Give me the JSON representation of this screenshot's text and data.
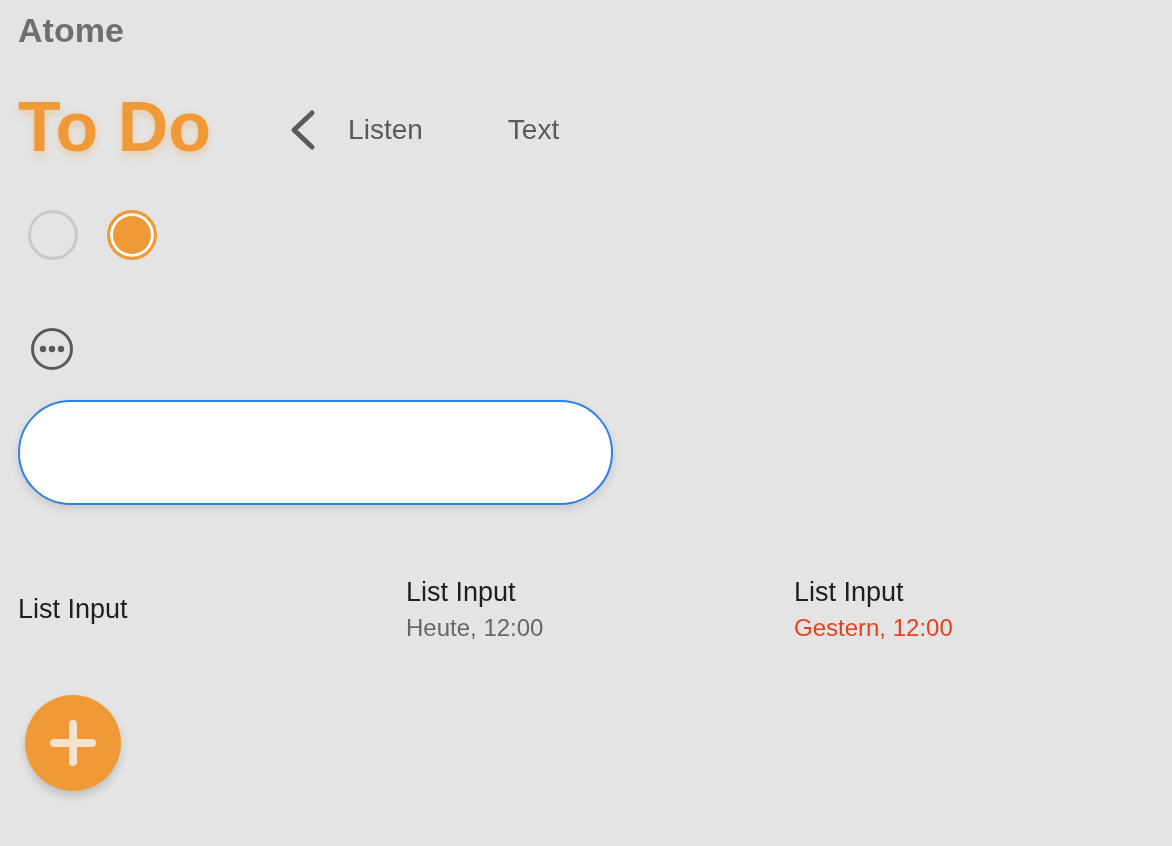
{
  "app": {
    "title": "Atome"
  },
  "header": {
    "title": "To Do",
    "back_button": "Listen",
    "text_button": "Text"
  },
  "radios": [
    {
      "selected": false
    },
    {
      "selected": true
    }
  ],
  "text_field": {
    "focused": true
  },
  "list_items": [
    {
      "title": "List Input"
    },
    {
      "title": "List Input",
      "date": "Heute, 12:00",
      "overdue": false
    },
    {
      "title": "List Input",
      "date": "Gestern, 12:00",
      "overdue": true
    }
  ]
}
